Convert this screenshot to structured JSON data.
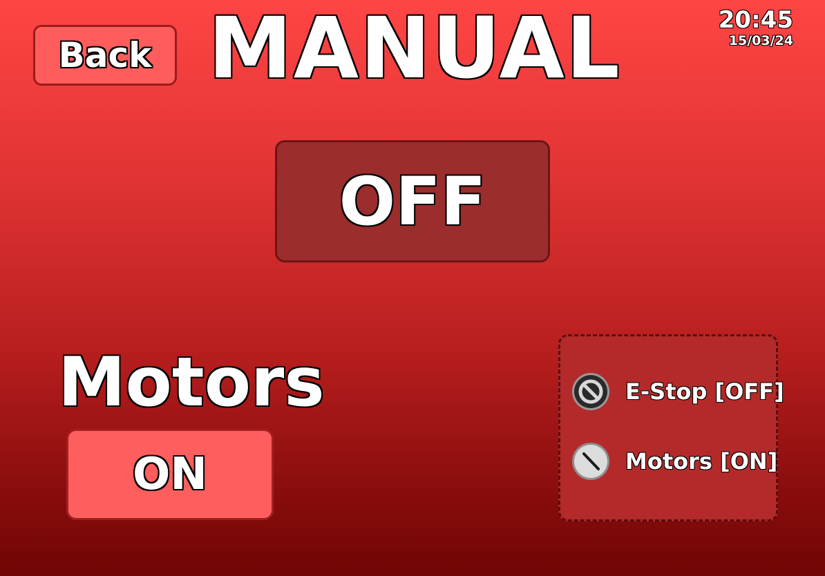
{
  "header": {
    "back_label": "Back",
    "title": "MANUAL",
    "time": "20:45",
    "date": "15/03/24"
  },
  "mode": {
    "state_label": "OFF"
  },
  "motors": {
    "label": "Motors",
    "button_label": "ON"
  },
  "status_panel": {
    "items": [
      {
        "icon": "estop-prohibited-icon",
        "text": "E-Stop [OFF]"
      },
      {
        "icon": "motors-status-icon",
        "text": "Motors [ON]"
      }
    ]
  },
  "colors": {
    "background_top": "#ff4545",
    "background_bottom": "#700505",
    "button_light": "#ff5c5c",
    "toggle_dark": "#9b2d2d",
    "panel": "#b42a2a"
  }
}
